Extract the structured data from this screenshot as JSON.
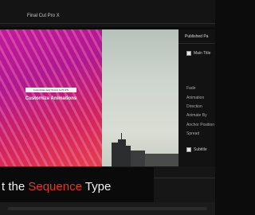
{
  "app": {
    "title": "Final Cut Pro X"
  },
  "viewer": {
    "caption_small": "Customize Any Preset in FCPX",
    "caption_main": "Customize Animations"
  },
  "inspector": {
    "title": "Published Pa",
    "main_title_label": "Main Title",
    "params": [
      "Fade",
      "Animation",
      "Direction",
      "Animate By",
      "Anchor Position",
      "Spread"
    ],
    "subtitle_label": "Subtitle"
  },
  "lower_third": {
    "text_before": "t the ",
    "text_accent": "Sequence",
    "text_after": " Type",
    "accent_color": "#e0392b"
  }
}
